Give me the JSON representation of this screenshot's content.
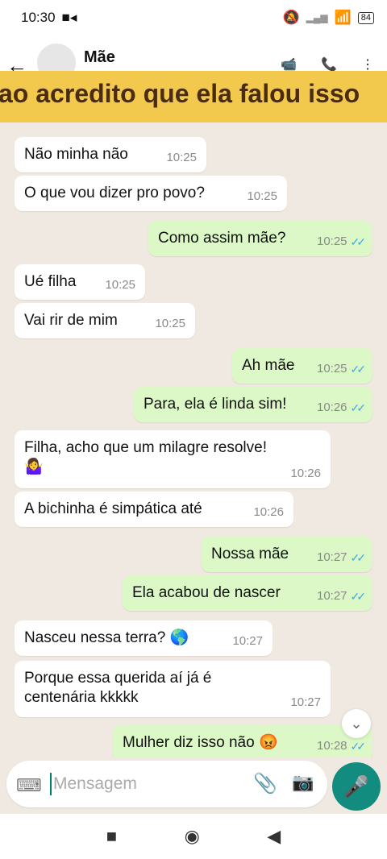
{
  "status": {
    "time": "10:30",
    "battery": "84"
  },
  "header": {
    "back_icon": "arrow-left-icon",
    "name": "Mãe",
    "icons": [
      "video-icon",
      "phone-icon",
      "more-vert-icon"
    ]
  },
  "banner": {
    "text": "ao acredito que ela falou isso"
  },
  "messages": [
    {
      "dir": "in",
      "text": "Não minha não",
      "time": "10:25"
    },
    {
      "dir": "in",
      "text": "O que vou dizer pro povo?",
      "time": "10:25"
    },
    {
      "dir": "out",
      "text": "Como assim mãe?",
      "time": "10:25"
    },
    {
      "dir": "in",
      "text": "Ué filha",
      "time": "10:25"
    },
    {
      "dir": "in",
      "text": "Vai rir de mim",
      "time": "10:25"
    },
    {
      "dir": "out",
      "text": "Ah mãe",
      "time": "10:25"
    },
    {
      "dir": "out",
      "text": "Para, ela é linda sim!",
      "time": "10:26"
    },
    {
      "dir": "in",
      "text": "Filha, acho que um milagre resolve!",
      "emoji": "🤷‍♀️",
      "time": "10:26"
    },
    {
      "dir": "in",
      "text": "A bichinha é simpática até",
      "time": "10:26"
    },
    {
      "dir": "out",
      "text": "Nossa mãe",
      "time": "10:27"
    },
    {
      "dir": "out",
      "text": "Ela acabou de nascer",
      "time": "10:27"
    },
    {
      "dir": "in",
      "text": "Nasceu nessa terra? 🌎",
      "time": "10:27"
    },
    {
      "dir": "in",
      "text": "Porque essa querida aí já é centenária kkkkk",
      "time": "10:27"
    },
    {
      "dir": "out",
      "text": "Mulher diz isso não 😡",
      "time": "10:28"
    }
  ],
  "input": {
    "placeholder": "Mensagem"
  },
  "nav": [
    "square-icon",
    "circle-icon",
    "triangle-back-icon"
  ]
}
